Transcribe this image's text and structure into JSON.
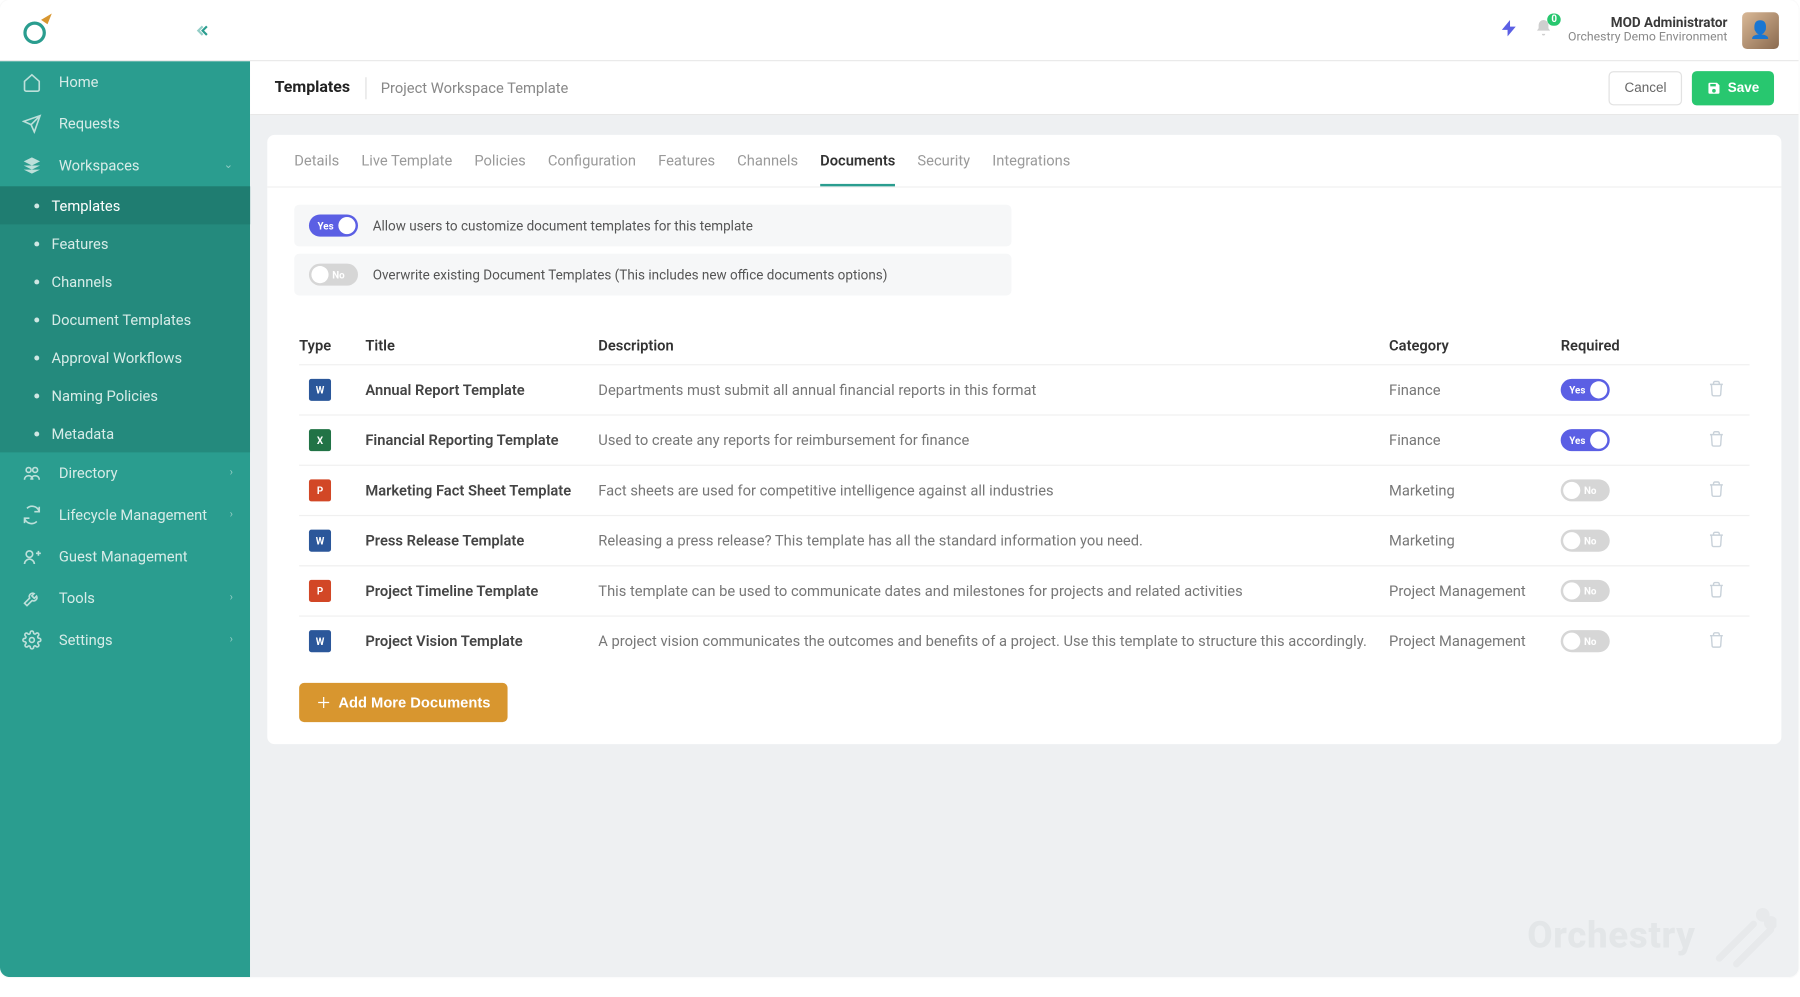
{
  "topbar": {
    "notifications_count": "0",
    "user_name": "MOD Administrator",
    "environment": "Orchestry Demo Environment"
  },
  "sidebar": {
    "items": [
      {
        "label": "Home"
      },
      {
        "label": "Requests"
      },
      {
        "label": "Workspaces"
      },
      {
        "label": "Directory"
      },
      {
        "label": "Lifecycle Management"
      },
      {
        "label": "Guest Management"
      },
      {
        "label": "Tools"
      },
      {
        "label": "Settings"
      }
    ],
    "workspaces_sub": [
      {
        "label": "Templates"
      },
      {
        "label": "Features"
      },
      {
        "label": "Channels"
      },
      {
        "label": "Document Templates"
      },
      {
        "label": "Approval Workflows"
      },
      {
        "label": "Naming Policies"
      },
      {
        "label": "Metadata"
      }
    ]
  },
  "header": {
    "breadcrumb_root": "Templates",
    "breadcrumb_current": "Project Workspace Template",
    "cancel_label": "Cancel",
    "save_label": "Save"
  },
  "tabs": [
    "Details",
    "Live Template",
    "Policies",
    "Configuration",
    "Features",
    "Channels",
    "Documents",
    "Security",
    "Integrations"
  ],
  "active_tab": "Documents",
  "settings": {
    "allow_customize": {
      "value": "Yes",
      "label": "Allow users to customize document templates for this template"
    },
    "overwrite": {
      "value": "No",
      "label": "Overwrite existing Document Templates (This includes new office documents options)"
    }
  },
  "table": {
    "columns": {
      "type": "Type",
      "title": "Title",
      "description": "Description",
      "category": "Category",
      "required": "Required"
    },
    "rows": [
      {
        "type": "word",
        "title": "Annual Report Template",
        "description": "Departments must submit all annual financial reports in this format",
        "category": "Finance",
        "required": true
      },
      {
        "type": "excel",
        "title": "Financial Reporting Template",
        "description": "Used to create any reports for reimbursement for finance",
        "category": "Finance",
        "required": true
      },
      {
        "type": "ppt",
        "title": "Marketing Fact Sheet Template",
        "description": "Fact sheets are used for competitive intelligence against all industries",
        "category": "Marketing",
        "required": false
      },
      {
        "type": "word",
        "title": "Press Release Template",
        "description": "Releasing a press release? This template has all the standard information you need.",
        "category": "Marketing",
        "required": false
      },
      {
        "type": "ppt",
        "title": "Project Timeline Template",
        "description": "This template can be used to communicate dates and milestones for projects and related activities",
        "category": "Project Management",
        "required": false
      },
      {
        "type": "word",
        "title": "Project Vision Template",
        "description": "A project vision communicates the outcomes and benefits of a project. Use this template to structure this accordingly.",
        "category": "Project Management",
        "required": false
      }
    ]
  },
  "toggle_labels": {
    "yes": "Yes",
    "no": "No"
  },
  "add_button": "Add More Documents",
  "watermark": "Orchestry"
}
